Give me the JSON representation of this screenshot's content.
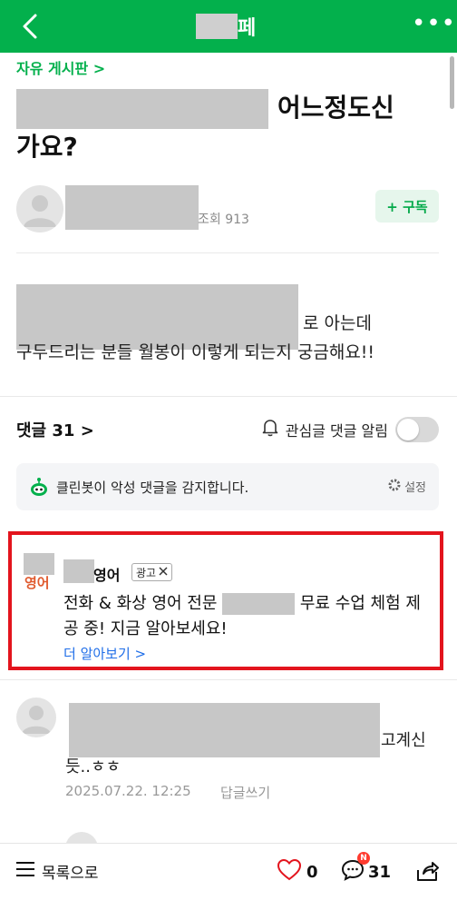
{
  "header": {
    "title_suffix": "페",
    "more_label": "•••"
  },
  "board_link": "자유 게시판 >",
  "post": {
    "title_end": "어느정도신",
    "title_line2": "가요?",
    "views": "조회 913",
    "subscribe_label": "+ 구독",
    "body_line2_end": "로 아는데",
    "body_line3": "구두드리는 분들 월봉이 이렇게 되는지 궁금해요!!"
  },
  "comments": {
    "count_label": "댓글 31 >",
    "alert_label": "관심글 댓글 알림",
    "cleanbot_text": "클린봇이 악성 댓글을 감지합니다.",
    "cleanbot_setting": "설정"
  },
  "ad": {
    "logo_text": "영어",
    "name": "영어",
    "badge": "광고",
    "text_before": "전화 & 화상 영어 전문",
    "text_after": "무료 수업 체험 제공 중! 지금 알아보세요!",
    "more_label": "더 알아보기 >"
  },
  "comment1": {
    "trail": "고계신",
    "line2": "듯..ㅎㅎ",
    "date": "2025.07.22. 12:25",
    "reply_label": "답글쓰기"
  },
  "bottom": {
    "list_label": "목록으로",
    "like_count": "0",
    "comment_count": "31",
    "comment_badge": "N"
  },
  "colors": {
    "brand_green": "#03b04c",
    "ad_border": "#e3141d",
    "link_blue": "#1f6ee8"
  }
}
